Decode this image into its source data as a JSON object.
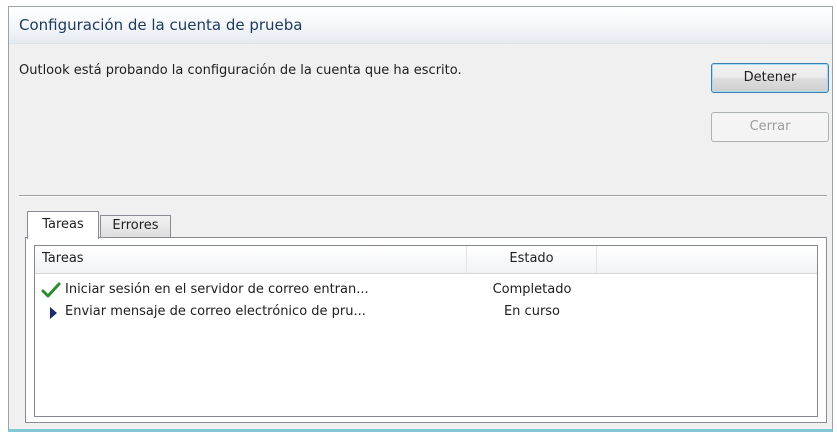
{
  "dialog": {
    "title": "Configuración de la cuenta de prueba",
    "message": "Outlook está probando la configuración de la cuenta que ha escrito.",
    "buttons": {
      "stop_label": "Detener",
      "close_label": "Cerrar",
      "close_enabled": false
    }
  },
  "tabs": [
    {
      "label": "Tareas",
      "active": true
    },
    {
      "label": "Errores",
      "active": false
    }
  ],
  "list": {
    "columns": [
      "Tareas",
      "Estado"
    ],
    "rows": [
      {
        "task": "Iniciar sesión en el servidor de correo entran...",
        "status": "Completado",
        "icon": "checkmark-icon"
      },
      {
        "task": "Enviar mensaje de correo electrónico de pru...",
        "status": "En curso",
        "icon": "arrow-right-icon"
      }
    ]
  },
  "colors": {
    "checkmark": "#2e8b2e",
    "arrow": "#1b2a6b",
    "title_text": "#1e395b"
  }
}
